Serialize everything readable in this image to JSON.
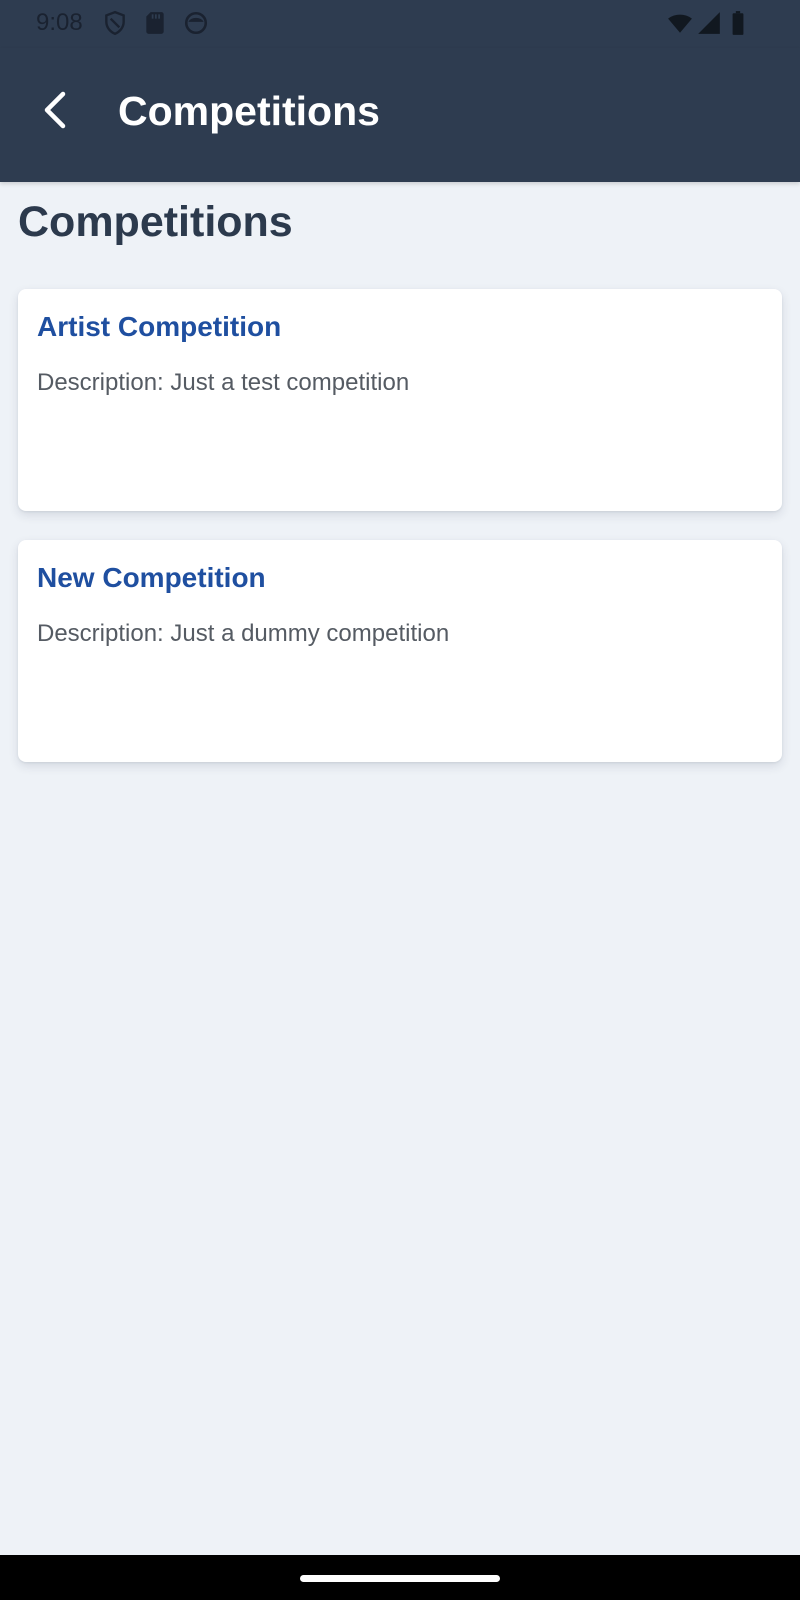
{
  "status_bar": {
    "time": "9:08",
    "icons": [
      "shield-icon",
      "sd-card-icon",
      "face-icon",
      "wifi-icon",
      "signal-icon",
      "battery-icon"
    ]
  },
  "app_bar": {
    "title": "Competitions",
    "back_icon": "chevron-left-icon"
  },
  "page": {
    "heading": "Competitions"
  },
  "competitions": [
    {
      "title": "Artist Competition",
      "description": "Description: Just a test competition"
    },
    {
      "title": "New Competition",
      "description": "Description: Just a dummy competition"
    }
  ],
  "colors": {
    "app_bar": "#2e3c50",
    "background": "#eef2f7",
    "card_title": "#1f4fa0",
    "heading": "#2c3a4d",
    "description": "#555b63"
  }
}
